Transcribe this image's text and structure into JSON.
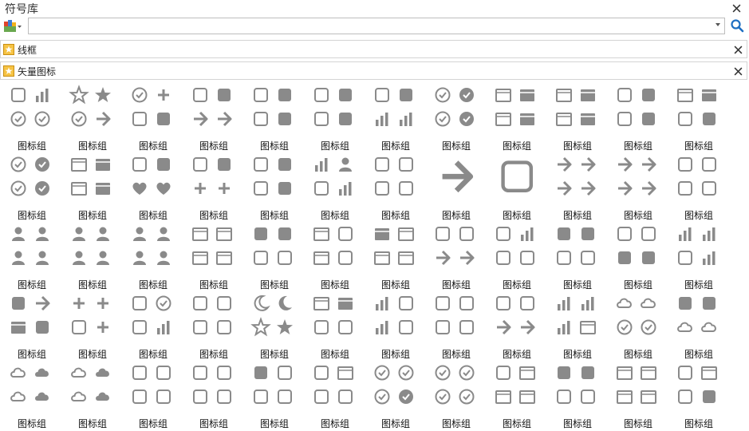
{
  "window": {
    "title": "符号库"
  },
  "search": {
    "value": "",
    "placeholder": ""
  },
  "sections": [
    {
      "label": "线框"
    },
    {
      "label": "矢量图标"
    }
  ],
  "colors": {
    "icon": "#8a8a8a",
    "accent": "#1e6fc2"
  },
  "grid": {
    "caption": "图标组",
    "rows": [
      [
        [
          "mic",
          "list",
          "globe",
          "close-circle"
        ],
        [
          "star-outline",
          "star",
          "compass",
          "navigate"
        ],
        [
          "plus-circle",
          "plus",
          "search",
          "search-filled"
        ],
        [
          "flag-outline",
          "flag",
          "reply-all",
          "reply-all-filled"
        ],
        [
          "sun",
          "sun-filled",
          "gear",
          "gear-filled"
        ],
        [
          "phone",
          "phone-filled",
          "video",
          "video-filled"
        ],
        [
          "chat",
          "chat-filled",
          "dots-grid",
          "dots-grid-filled"
        ],
        [
          "clock",
          "clock-filled",
          "clock-half",
          "clock-half-filled"
        ],
        [
          "doc-badge",
          "doc-badge-filled",
          "doc",
          "doc-filled"
        ],
        [
          "layers",
          "layers-filled",
          "window-stack",
          "window-stack-filled"
        ],
        [
          "volume",
          "volume-filled",
          "toggle",
          "toggle-filled"
        ],
        [
          "folder",
          "folder-filled",
          "bubble",
          "bubble-filled"
        ]
      ],
      [
        [
          "check-circle",
          "check-circle-filled",
          "info-circle",
          "info-circle-filled"
        ],
        [
          "archive",
          "archive-filled",
          "book",
          "book-filled"
        ],
        [
          "music-note",
          "music-note-filled",
          "heart",
          "heart-filled"
        ],
        [
          "music-notes",
          "music-notes-filled",
          "plus-bold",
          "minus-bold"
        ],
        [
          "stop",
          "stop-filled",
          "pause",
          "pause-filled"
        ],
        [
          "playlist",
          "user-music",
          "wifi",
          "signal"
        ],
        [
          "skip-back",
          "skip-forward",
          "rewind",
          "fast-forward"
        ],
        [
          "arrows-4way"
        ],
        [
          "move-4way"
        ],
        [
          "arrow-left",
          "arrow-right",
          "arrow-down",
          "arrow-up"
        ],
        [
          "chevron-left",
          "chevron-right",
          "chevron-down",
          "chevron-up"
        ],
        [
          "sign-in",
          "sign-out",
          "download-box",
          "upload-box"
        ]
      ],
      [
        [
          "user",
          "users",
          "user-add",
          "user-remove"
        ],
        [
          "user-outline",
          "users-outline",
          "user-add-outline",
          "user-remove-outline"
        ],
        [
          "user-search",
          "user-check",
          "user-gear",
          "user-sync"
        ],
        [
          "page",
          "page-edit",
          "page-add",
          "page-remove"
        ],
        [
          "calculator",
          "trash",
          "alarm",
          "flashlight"
        ],
        [
          "screen-share",
          "edit",
          "image",
          "camera"
        ],
        [
          "mail",
          "mail-open",
          "folder-add",
          "folder-remove"
        ],
        [
          "link",
          "link-2",
          "split-arrow",
          "send"
        ],
        [
          "mute",
          "no-signal",
          "battery-low",
          "battery-full"
        ],
        [
          "unlock",
          "lock",
          "refresh",
          "refresh-lock"
        ],
        [
          "bluetooth",
          "share",
          "location",
          "bulb"
        ],
        [
          "menu",
          "grid-4",
          "more-vertical",
          "list-bullets"
        ]
      ],
      [
        [
          "home",
          "undo",
          "facebook",
          "gift"
        ],
        [
          "checkmark",
          "xmark",
          "download-tray",
          "checkbox"
        ],
        [
          "cart",
          "pie-target",
          "thermometer",
          "bar-chart"
        ],
        [
          "at",
          "vibrate",
          "comment",
          "warning"
        ],
        [
          "moon-outline",
          "moon",
          "moon-star-outline",
          "moon-star"
        ],
        [
          "mail-check",
          "mail-check-filled",
          "map-search",
          "map-edit"
        ],
        [
          "sort",
          "swap",
          "sort-2",
          "swap-2"
        ],
        [
          "repeat",
          "transfer",
          "shuffle",
          "repeat-one"
        ],
        [
          "rotate",
          "stopwatch",
          "turn-left",
          "turn-right"
        ],
        [
          "sliders",
          "apps",
          "line-chart",
          "fullscreen"
        ],
        [
          "cloud-down",
          "cloud-up",
          "smile",
          "smile-outline"
        ],
        [
          "hand",
          "airplane",
          "cloud-lightning",
          "cloud-lightning-2"
        ]
      ],
      [
        [
          "cloud",
          "cloud-filled",
          "rain",
          "rain-filled"
        ],
        [
          "partly-sunny",
          "partly-sunny-filled",
          "clouds",
          "clouds-filled"
        ],
        [
          "male",
          "female",
          "transgender",
          "fork"
        ],
        [
          "crop",
          "resize",
          "crop-2",
          "expand"
        ],
        [
          "bell",
          "bell-off",
          "wrench",
          "headphones"
        ],
        [
          "factory",
          "billboard",
          "signpost",
          "signpost-left"
        ],
        [
          "skype",
          "verified",
          "x-circle",
          "plus-circle-filled"
        ],
        [
          "power",
          "power-off",
          "timer",
          "contrast"
        ],
        [
          "sync",
          "presentation",
          "bank",
          "brick"
        ],
        [
          "drop",
          "apple",
          "eye",
          "flask"
        ],
        [
          "calendar",
          "windows",
          "store",
          "keyboard"
        ],
        [
          "quote",
          "copy",
          "cursor",
          "airplane-2"
        ]
      ]
    ]
  }
}
